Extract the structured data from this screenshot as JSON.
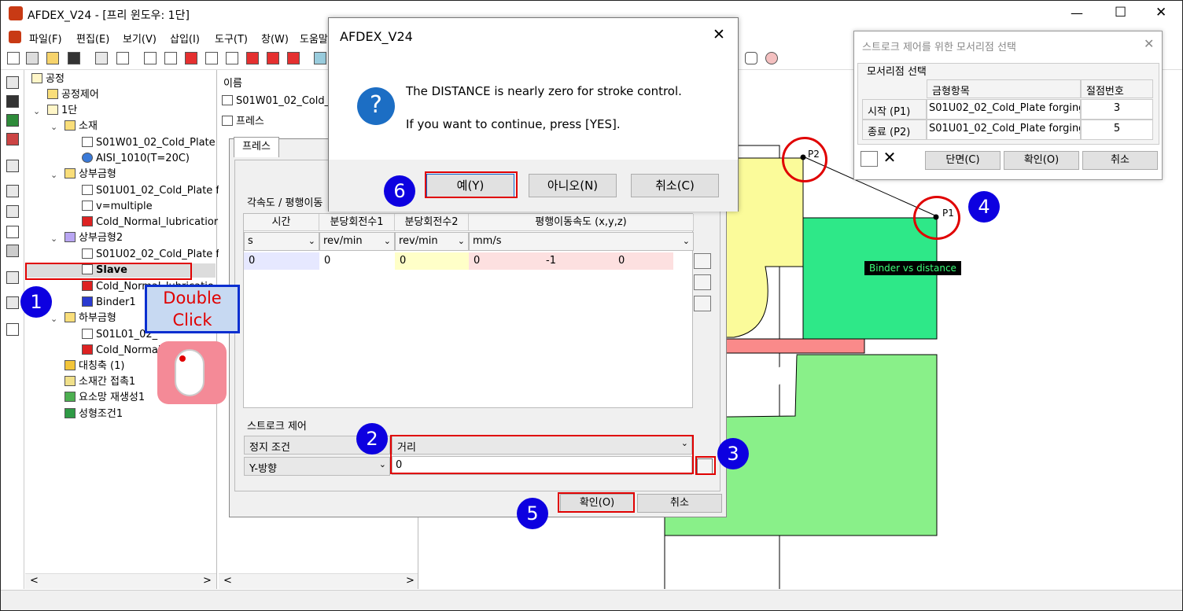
{
  "window": {
    "title": "AFDEX_V24 - [프리 윈도우: 1단]",
    "controls": {
      "minimize": "—",
      "maximize": "☐",
      "close": "✕"
    }
  },
  "menu": [
    "파일(F)",
    "편집(E)",
    "보기(V)",
    "삽입(I)",
    "도구(T)",
    "창(W)",
    "도움말"
  ],
  "tree": {
    "nodes": [
      {
        "label": "공정",
        "icon": "folder-icon"
      },
      {
        "label": "공정제어",
        "icon": "folder-icon"
      },
      {
        "label": "1단",
        "icon": "folder-icon"
      },
      {
        "label": "소재",
        "icon": "cube-icon"
      },
      {
        "label": "S01W01_02_Cold_Plate",
        "icon": "mesh-icon"
      },
      {
        "label": "AISI_1010(T=20C)",
        "icon": "material-icon"
      },
      {
        "label": "상부금형",
        "icon": "die-icon"
      },
      {
        "label": "S01U01_02_Cold_Plate f",
        "icon": "mesh-icon"
      },
      {
        "label": "v=multiple",
        "icon": "press-icon"
      },
      {
        "label": "Cold_Normal_lubricatior",
        "icon": "lubricant-icon"
      },
      {
        "label": "상부금형2",
        "icon": "die-icon"
      },
      {
        "label": "S01U02_02_Cold_Plate f",
        "icon": "mesh-icon"
      },
      {
        "label": "Slave",
        "icon": "press-icon"
      },
      {
        "label": "Cold_Normal_lubricatio",
        "icon": "lubricant-icon"
      },
      {
        "label": "Binder1",
        "icon": "binder-icon"
      },
      {
        "label": "하부금형",
        "icon": "die-icon"
      },
      {
        "label": "S01L01_02_",
        "icon": "mesh-icon"
      },
      {
        "label": "Cold_Normal",
        "icon": "lubricant-icon"
      },
      {
        "label": "대칭축 (1)",
        "icon": "axis-icon"
      },
      {
        "label": "소재간 접촉1",
        "icon": "contact-icon"
      },
      {
        "label": "요소망 재생성1",
        "icon": "remesh-icon"
      },
      {
        "label": "성형조건1",
        "icon": "condition-icon"
      }
    ],
    "scroll_left": "<",
    "scroll_right": ">"
  },
  "panel2": {
    "header": "이름",
    "item1": "S01W01_02_Cold_P",
    "item2": "프레스",
    "scroll_left": "<",
    "scroll_right": ">"
  },
  "press_dialog": {
    "tab": "프레스",
    "section": "각속도 / 평행이동",
    "columns": [
      "시간",
      "분당회전수1",
      "분당회전수2",
      "평행이동속도 (x,y,z)"
    ],
    "units": [
      "s",
      "rev/min",
      "rev/min",
      "mm/s"
    ],
    "row": [
      "0",
      "0",
      "0",
      "0",
      "-1",
      "0"
    ],
    "stroke_section": "스트로크 제어",
    "stop_condition_label": "정지 조건",
    "stop_condition_value": "거리",
    "direction_value": "Y-방향",
    "distance_value": "0",
    "ok": "확인(O)",
    "cancel": "취소"
  },
  "message_box": {
    "title": "AFDEX_V24",
    "icon": "?",
    "line1": "The DISTANCE is nearly zero for stroke control.",
    "line2": "If you want to continue, press [YES].",
    "yes": "예(Y)",
    "no": "아니오(N)",
    "cancel": "취소(C)",
    "close": "✕"
  },
  "node_dialog": {
    "title": "스트로크 제어를 위한 모서리점 선택",
    "group": "모서리점 선택",
    "col_item": "금형항목",
    "col_node": "절점번호",
    "rows": [
      {
        "label": "시작 (P1)",
        "item": "S01U02_02_Cold_Plate forging1",
        "node": "3"
      },
      {
        "label": "종료 (P2)",
        "item": "S01U01_02_Cold_Plate forging1",
        "node": "5"
      }
    ],
    "section_btn": "단면(C)",
    "ok": "확인(O)",
    "cancel": "취소",
    "close": "✕"
  },
  "viewport": {
    "p1": "P1",
    "p2": "P2",
    "label": "Binder vs distance"
  },
  "annotations": {
    "double_click": "Double\nClick",
    "steps": [
      "1",
      "2",
      "3",
      "4",
      "5",
      "6"
    ]
  },
  "colors": {
    "accent_red": "#e00000",
    "bubble_blue": "#0d00e0",
    "yellow_die": "#fbfb9a",
    "green_die": "#2ee888",
    "light_green": "#89f089",
    "pink_plate": "#fa8a8a"
  }
}
